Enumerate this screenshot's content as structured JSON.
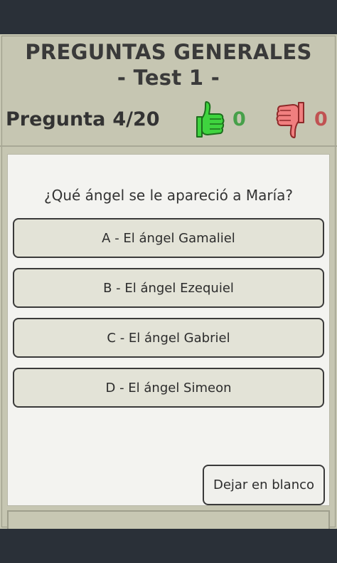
{
  "header": {
    "title_line1": "PREGUNTAS GENERALES",
    "title_line2": "- Test 1 -"
  },
  "status": {
    "question_label": "Pregunta",
    "question_progress": "4/20",
    "correct_count": "0",
    "wrong_count": "0"
  },
  "quiz": {
    "question": "¿Qué ángel se le apareció a María?",
    "answers": [
      "A - El ángel Gamaliel",
      "B - El ángel Ezequiel",
      "C - El ángel Gabriel",
      "D - El ángel Simeon"
    ],
    "skip_label": "Dejar en blanco"
  },
  "icons": {
    "correct": "thumbs-up-icon",
    "wrong": "thumbs-down-icon"
  },
  "colors": {
    "thumb_up": "#3fd43f",
    "thumb_down": "#f07f7f",
    "correct_text": "#47a04a",
    "wrong_text": "#c05252",
    "frame": "#c6c6b2",
    "answer_bg": "#e3e3d7"
  }
}
